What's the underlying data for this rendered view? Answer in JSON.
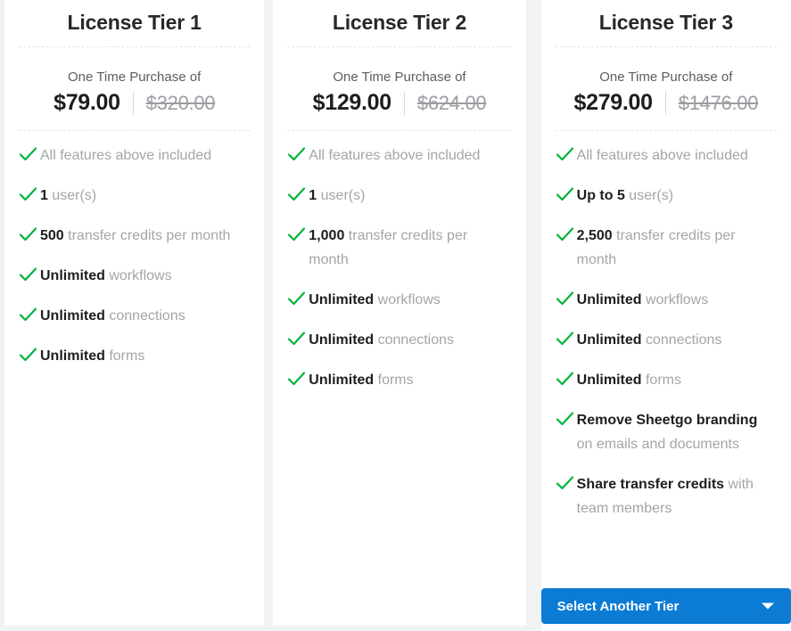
{
  "theme": {
    "accent_blue": "#0b7bd4",
    "check_green": "#00b33c",
    "text_dark": "#1c1e21",
    "text_muted": "#a2a5a9",
    "page_background": "#f1f2f3"
  },
  "tiers": [
    {
      "title": "License Tier 1",
      "price_caption": "One Time Purchase of",
      "price_current": "$79.00",
      "price_old": "$320.00",
      "features": [
        {
          "strong": "",
          "rest": "All features above included"
        },
        {
          "strong": "1",
          "rest": " user(s)"
        },
        {
          "strong": "500",
          "rest": " transfer credits per month"
        },
        {
          "strong": "Unlimited",
          "rest": " workflows"
        },
        {
          "strong": "Unlimited",
          "rest": " connections"
        },
        {
          "strong": "Unlimited",
          "rest": " forms"
        }
      ],
      "button": null
    },
    {
      "title": "License Tier 2",
      "price_caption": "One Time Purchase of",
      "price_current": "$129.00",
      "price_old": "$624.00",
      "features": [
        {
          "strong": "",
          "rest": "All features above included"
        },
        {
          "strong": "1",
          "rest": " user(s)"
        },
        {
          "strong": "1,000",
          "rest": " transfer credits per month"
        },
        {
          "strong": "Unlimited",
          "rest": " workflows"
        },
        {
          "strong": "Unlimited",
          "rest": " connections"
        },
        {
          "strong": "Unlimited",
          "rest": " forms"
        }
      ],
      "button": null
    },
    {
      "title": "License Tier 3",
      "price_caption": "One Time Purchase of",
      "price_current": "$279.00",
      "price_old": "$1476.00",
      "features": [
        {
          "strong": "",
          "rest": "All features above included"
        },
        {
          "strong": "Up to 5",
          "rest": " user(s)"
        },
        {
          "strong": "2,500",
          "rest": " transfer credits per month"
        },
        {
          "strong": "Unlimited",
          "rest": " workflows"
        },
        {
          "strong": "Unlimited",
          "rest": " connections"
        },
        {
          "strong": "Unlimited",
          "rest": " forms"
        },
        {
          "strong": "Remove Sheetgo branding",
          "rest": " on emails and documents"
        },
        {
          "strong": "Share transfer credits",
          "rest": " with team members"
        }
      ],
      "button": {
        "label": "Select Another Tier",
        "icon": "chevron-down-icon"
      }
    }
  ]
}
